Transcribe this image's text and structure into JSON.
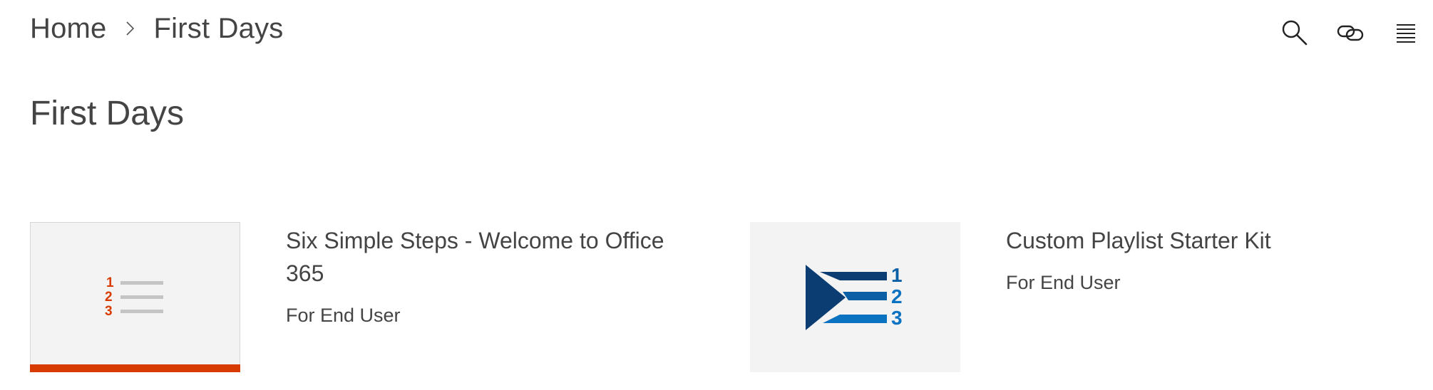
{
  "breadcrumb": {
    "home": "Home",
    "current": "First Days"
  },
  "toolbar": {
    "search_icon": "search-icon",
    "link_icon": "link-icon",
    "menu_icon": "menu-icon"
  },
  "page": {
    "title": "First Days"
  },
  "cards": [
    {
      "title": "Six Simple Steps - Welcome to Office 365",
      "audience": "For End User",
      "icon": "numbered-list-icon",
      "accent": "#d83b01"
    },
    {
      "title": "Custom Playlist Starter Kit",
      "audience": "For End User",
      "icon": "playlist-icon",
      "accent": "#0078d4"
    }
  ],
  "colors": {
    "text": "#444444",
    "thumb_bg": "#f3f3f3",
    "orange": "#d83b01",
    "dark_blue": "#0b3d73",
    "blue": "#0078d4"
  }
}
